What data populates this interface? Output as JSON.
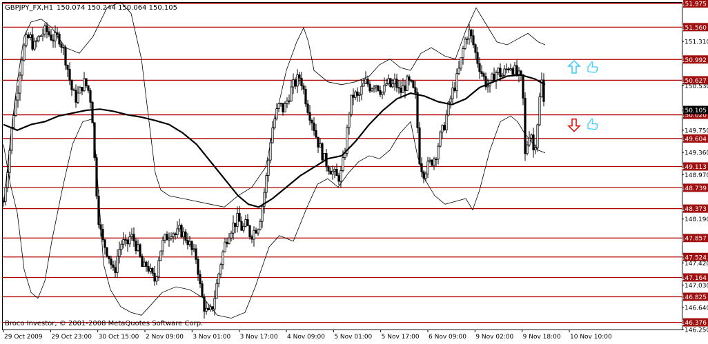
{
  "header": {
    "symbol": "GBPJPY_FX,H1",
    "ohlc": "150.074 150.244 150.064 150.105"
  },
  "footer": {
    "copyright": "Broco Investor, © 2001-2008 MetaQuotes Software Corp."
  },
  "colors": {
    "background": "#ffffff",
    "frame": "#000000",
    "level_line": "#b00000",
    "level_label_bg": "#a01010",
    "level_label_text": "#ffffff",
    "current_price_bg": "#000000",
    "current_price_text": "#ffffff",
    "candles": "#000000",
    "bands": "#000000",
    "moving_average": "#000000",
    "signal_up": "#33ccff",
    "signal_down": "#e00000",
    "hand": "#33ccff"
  },
  "chart_data": {
    "type": "candlestick",
    "title": "GBPJPY_FX,H1",
    "ylim": [
      146.25,
      152.0
    ],
    "time_labels": [
      "29 Oct 2009",
      "29 Oct 23:00",
      "30 Oct 15:00",
      "2 Nov 09:00",
      "3 Nov 01:00",
      "3 Nov 17:00",
      "4 Nov 09:00",
      "5 Nov 01:00",
      "5 Nov 17:00",
      "6 Nov 09:00",
      "9 Nov 02:00",
      "9 Nov 18:00",
      "10 Nov 10:00"
    ],
    "price_ticks": [
      151.31,
      150.53,
      150.105,
      149.75,
      149.36,
      148.97,
      148.19,
      147.42,
      147.03,
      146.64,
      146.25
    ],
    "levels": [
      151.975,
      151.56,
      150.992,
      150.627,
      150.02,
      149.604,
      149.113,
      148.739,
      148.373,
      147.857,
      147.524,
      147.164,
      146.825,
      146.376
    ],
    "level_labels": [
      "151.975",
      "151.560",
      "150.992",
      "150.627",
      "150.020",
      "149.604",
      "149.113",
      "148.739",
      "148.373",
      "147.857",
      "147.524",
      "147.164",
      "146.825",
      "146.376"
    ],
    "current_price": 150.105,
    "current_price_label": "150.105",
    "signals": [
      {
        "direction": "up",
        "price": 150.85
      },
      {
        "direction": "down",
        "price": 149.85
      }
    ],
    "close_path": [
      [
        0,
        148.5
      ],
      [
        8,
        149.3
      ],
      [
        14,
        150.0
      ],
      [
        20,
        150.4
      ],
      [
        26,
        151.0
      ],
      [
        32,
        151.3
      ],
      [
        38,
        151.4
      ],
      [
        44,
        151.2
      ],
      [
        50,
        151.35
      ],
      [
        56,
        151.45
      ],
      [
        62,
        151.5
      ],
      [
        68,
        151.4
      ],
      [
        74,
        151.35
      ],
      [
        80,
        151.4
      ],
      [
        86,
        151.2
      ],
      [
        92,
        150.9
      ],
      [
        98,
        150.5
      ],
      [
        104,
        150.3
      ],
      [
        110,
        150.4
      ],
      [
        116,
        150.6
      ],
      [
        122,
        150.5
      ],
      [
        128,
        150.2
      ],
      [
        133,
        149.0
      ],
      [
        138,
        148.2
      ],
      [
        143,
        147.8
      ],
      [
        148,
        147.7
      ],
      [
        154,
        147.5
      ],
      [
        160,
        147.2
      ],
      [
        166,
        147.6
      ],
      [
        172,
        147.8
      ],
      [
        178,
        147.7
      ],
      [
        184,
        147.9
      ],
      [
        190,
        147.8
      ],
      [
        196,
        147.6
      ],
      [
        202,
        147.3
      ],
      [
        208,
        147.4
      ],
      [
        214,
        147.2
      ],
      [
        220,
        147.1
      ],
      [
        226,
        147.6
      ],
      [
        232,
        147.8
      ],
      [
        238,
        147.9
      ],
      [
        244,
        148.0
      ],
      [
        250,
        147.9
      ],
      [
        256,
        148.0
      ],
      [
        262,
        147.9
      ],
      [
        268,
        147.8
      ],
      [
        274,
        147.6
      ],
      [
        280,
        147.5
      ],
      [
        286,
        146.9
      ],
      [
        292,
        146.6
      ],
      [
        298,
        146.5
      ],
      [
        304,
        146.7
      ],
      [
        310,
        147.1
      ],
      [
        316,
        147.5
      ],
      [
        322,
        147.8
      ],
      [
        328,
        148.0
      ],
      [
        334,
        148.1
      ],
      [
        340,
        148.2
      ],
      [
        346,
        148.0
      ],
      [
        352,
        148.1
      ],
      [
        358,
        147.9
      ],
      [
        364,
        148.0
      ],
      [
        370,
        148.1
      ],
      [
        376,
        148.5
      ],
      [
        382,
        149.0
      ],
      [
        388,
        149.7
      ],
      [
        394,
        150.0
      ],
      [
        400,
        150.2
      ],
      [
        406,
        150.1
      ],
      [
        412,
        150.3
      ],
      [
        418,
        150.5
      ],
      [
        424,
        150.6
      ],
      [
        430,
        150.7
      ],
      [
        436,
        150.4
      ],
      [
        442,
        150.1
      ],
      [
        448,
        149.9
      ],
      [
        454,
        149.6
      ],
      [
        460,
        149.4
      ],
      [
        466,
        149.2
      ],
      [
        472,
        149.1
      ],
      [
        478,
        149.0
      ],
      [
        484,
        148.9
      ],
      [
        490,
        149.0
      ],
      [
        496,
        149.5
      ],
      [
        502,
        150.2
      ],
      [
        508,
        150.4
      ],
      [
        514,
        150.3
      ],
      [
        520,
        150.5
      ],
      [
        526,
        150.6
      ],
      [
        532,
        150.5
      ],
      [
        538,
        150.6
      ],
      [
        544,
        150.5
      ],
      [
        550,
        150.4
      ],
      [
        556,
        150.6
      ],
      [
        562,
        150.5
      ],
      [
        568,
        150.6
      ],
      [
        574,
        150.4
      ],
      [
        580,
        150.5
      ],
      [
        586,
        150.6
      ],
      [
        592,
        150.5
      ],
      [
        598,
        150.3
      ],
      [
        602,
        149.3
      ],
      [
        608,
        149.0
      ],
      [
        614,
        149.1
      ],
      [
        620,
        149.2
      ],
      [
        626,
        149.3
      ],
      [
        632,
        149.6
      ],
      [
        638,
        149.8
      ],
      [
        644,
        150.1
      ],
      [
        650,
        150.4
      ],
      [
        656,
        150.6
      ],
      [
        662,
        150.9
      ],
      [
        668,
        151.3
      ],
      [
        674,
        151.5
      ],
      [
        680,
        151.3
      ],
      [
        686,
        151.0
      ],
      [
        692,
        150.8
      ],
      [
        698,
        150.6
      ],
      [
        704,
        150.5
      ],
      [
        710,
        150.7
      ],
      [
        716,
        150.8
      ],
      [
        722,
        150.7
      ],
      [
        728,
        150.8
      ],
      [
        734,
        150.9
      ],
      [
        740,
        150.8
      ],
      [
        746,
        150.7
      ],
      [
        752,
        150.6
      ],
      [
        756,
        149.3
      ],
      [
        760,
        149.6
      ],
      [
        764,
        149.8
      ],
      [
        768,
        149.4
      ],
      [
        772,
        149.6
      ],
      [
        776,
        150.2
      ],
      [
        780,
        150.6
      ],
      [
        784,
        150.1
      ]
    ],
    "moving_average": [
      [
        0,
        149.85
      ],
      [
        20,
        149.75
      ],
      [
        40,
        149.85
      ],
      [
        60,
        149.9
      ],
      [
        80,
        150.0
      ],
      [
        100,
        150.05
      ],
      [
        120,
        150.1
      ],
      [
        140,
        150.12
      ],
      [
        160,
        150.08
      ],
      [
        180,
        150.02
      ],
      [
        200,
        149.98
      ],
      [
        220,
        149.92
      ],
      [
        240,
        149.85
      ],
      [
        260,
        149.7
      ],
      [
        280,
        149.5
      ],
      [
        300,
        149.2
      ],
      [
        320,
        148.9
      ],
      [
        340,
        148.6
      ],
      [
        355,
        148.45
      ],
      [
        370,
        148.4
      ],
      [
        390,
        148.55
      ],
      [
        410,
        148.75
      ],
      [
        430,
        148.95
      ],
      [
        450,
        149.1
      ],
      [
        470,
        149.25
      ],
      [
        490,
        149.3
      ],
      [
        510,
        149.55
      ],
      [
        530,
        149.85
      ],
      [
        550,
        150.1
      ],
      [
        570,
        150.3
      ],
      [
        590,
        150.4
      ],
      [
        610,
        150.35
      ],
      [
        630,
        150.25
      ],
      [
        650,
        150.2
      ],
      [
        670,
        150.3
      ],
      [
        690,
        150.5
      ],
      [
        710,
        150.6
      ],
      [
        730,
        150.7
      ],
      [
        750,
        150.72
      ],
      [
        770,
        150.65
      ],
      [
        785,
        150.55
      ]
    ],
    "upper_band": [
      [
        0,
        148.4
      ],
      [
        10,
        149.6
      ],
      [
        20,
        150.6
      ],
      [
        30,
        151.4
      ],
      [
        40,
        151.65
      ],
      [
        55,
        151.7
      ],
      [
        70,
        151.55
      ],
      [
        90,
        151.2
      ],
      [
        110,
        151.1
      ],
      [
        130,
        151.4
      ],
      [
        150,
        151.9
      ],
      [
        170,
        152.0
      ],
      [
        185,
        151.8
      ],
      [
        200,
        151.0
      ],
      [
        210,
        150.0
      ],
      [
        220,
        149.0
      ],
      [
        228,
        148.7
      ],
      [
        240,
        148.6
      ],
      [
        260,
        148.55
      ],
      [
        280,
        148.5
      ],
      [
        300,
        148.45
      ],
      [
        320,
        148.4
      ],
      [
        340,
        148.6
      ],
      [
        360,
        148.75
      ],
      [
        380,
        149.1
      ],
      [
        395,
        150.0
      ],
      [
        410,
        150.8
      ],
      [
        425,
        151.3
      ],
      [
        435,
        151.55
      ],
      [
        442,
        151.3
      ],
      [
        450,
        150.8
      ],
      [
        470,
        150.6
      ],
      [
        490,
        150.55
      ],
      [
        510,
        150.6
      ],
      [
        530,
        150.7
      ],
      [
        545,
        150.9
      ],
      [
        560,
        151.0
      ],
      [
        575,
        150.85
      ],
      [
        590,
        150.8
      ],
      [
        605,
        151.1
      ],
      [
        620,
        151.2
      ],
      [
        640,
        151.05
      ],
      [
        655,
        151.0
      ],
      [
        670,
        151.5
      ],
      [
        685,
        151.9
      ],
      [
        700,
        151.6
      ],
      [
        715,
        151.3
      ],
      [
        730,
        151.25
      ],
      [
        745,
        151.35
      ],
      [
        760,
        151.45
      ],
      [
        775,
        151.3
      ],
      [
        785,
        151.25
      ]
    ],
    "lower_band": [
      [
        0,
        149.5
      ],
      [
        10,
        148.8
      ],
      [
        20,
        148.3
      ],
      [
        30,
        147.3
      ],
      [
        40,
        146.9
      ],
      [
        50,
        146.8
      ],
      [
        60,
        147.1
      ],
      [
        70,
        147.8
      ],
      [
        85,
        148.7
      ],
      [
        100,
        149.5
      ],
      [
        115,
        149.9
      ],
      [
        130,
        149.95
      ],
      [
        138,
        148.6
      ],
      [
        145,
        147.4
      ],
      [
        155,
        146.95
      ],
      [
        170,
        146.65
      ],
      [
        185,
        146.55
      ],
      [
        200,
        146.5
      ],
      [
        215,
        146.7
      ],
      [
        230,
        146.9
      ],
      [
        250,
        147.0
      ],
      [
        270,
        146.95
      ],
      [
        290,
        146.8
      ],
      [
        310,
        146.5
      ],
      [
        330,
        146.45
      ],
      [
        350,
        146.55
      ],
      [
        365,
        147.0
      ],
      [
        385,
        147.7
      ],
      [
        400,
        147.9
      ],
      [
        420,
        147.8
      ],
      [
        440,
        148.4
      ],
      [
        455,
        148.8
      ],
      [
        470,
        148.9
      ],
      [
        485,
        148.75
      ],
      [
        500,
        149.0
      ],
      [
        515,
        149.2
      ],
      [
        530,
        149.3
      ],
      [
        545,
        149.25
      ],
      [
        560,
        149.4
      ],
      [
        575,
        149.7
      ],
      [
        590,
        149.9
      ],
      [
        600,
        149.3
      ],
      [
        610,
        148.9
      ],
      [
        625,
        148.6
      ],
      [
        640,
        148.45
      ],
      [
        655,
        148.5
      ],
      [
        670,
        148.55
      ],
      [
        680,
        148.35
      ],
      [
        690,
        148.7
      ],
      [
        705,
        149.4
      ],
      [
        720,
        149.9
      ],
      [
        735,
        150.0
      ],
      [
        745,
        149.9
      ],
      [
        755,
        149.7
      ],
      [
        765,
        149.55
      ],
      [
        775,
        149.4
      ],
      [
        785,
        149.35
      ]
    ]
  }
}
